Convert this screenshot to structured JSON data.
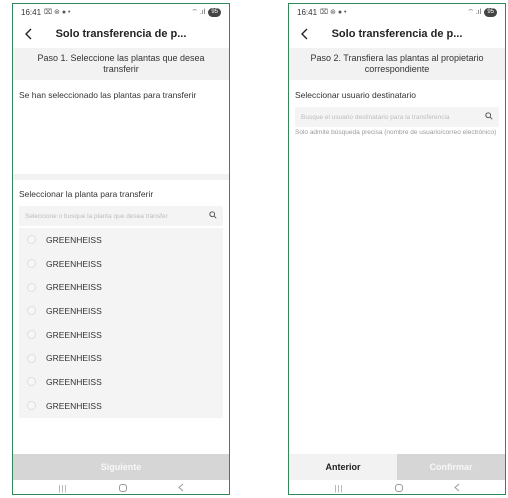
{
  "status": {
    "time": "16:41",
    "left_icons": "⌧ ⊛ ● •",
    "right_icons": "⌔ .ıl",
    "battery": "95"
  },
  "screen1": {
    "title": "Solo transferencia de p...",
    "step": "Paso 1. Seleccione las plantas que desea transferir",
    "selected_label": "Se han seleccionado las plantas para transferir",
    "select_label": "Seleccionar la planta para transferir",
    "search": {
      "placeholder": "Seleccione o busque la planta que desea transfer"
    },
    "plants": [
      {
        "name": "GREENHEISS"
      },
      {
        "name": "GREENHEISS"
      },
      {
        "name": "GREENHEISS"
      },
      {
        "name": "GREENHEISS"
      },
      {
        "name": "GREENHEISS"
      },
      {
        "name": "GREENHEISS"
      },
      {
        "name": "GREENHEISS"
      },
      {
        "name": "GREENHEISS"
      }
    ],
    "next_label": "Siguiente"
  },
  "screen2": {
    "title": "Solo transferencia de p...",
    "step": "Paso 2. Transfiera las plantas al propietario correspondiente",
    "select_user_label": "Seleccionar usuario destinatario",
    "search": {
      "placeholder": "Busque el usuario destinatario para la transferencia"
    },
    "hint": "Solo admite búsqueda precisa (nombre de usuario/correo electrónico)",
    "prev_label": "Anterior",
    "confirm_label": "Confirmar"
  },
  "icons": {
    "back": "back-arrow-icon",
    "search": "search-icon",
    "nav_recent": "recent-apps-icon",
    "nav_home": "home-icon",
    "nav_back": "nav-back-icon"
  },
  "colors": {
    "frame_border": "#2e8b57",
    "disabled_button": "#d6d6d6",
    "panel_bg": "#f2f2f2"
  }
}
